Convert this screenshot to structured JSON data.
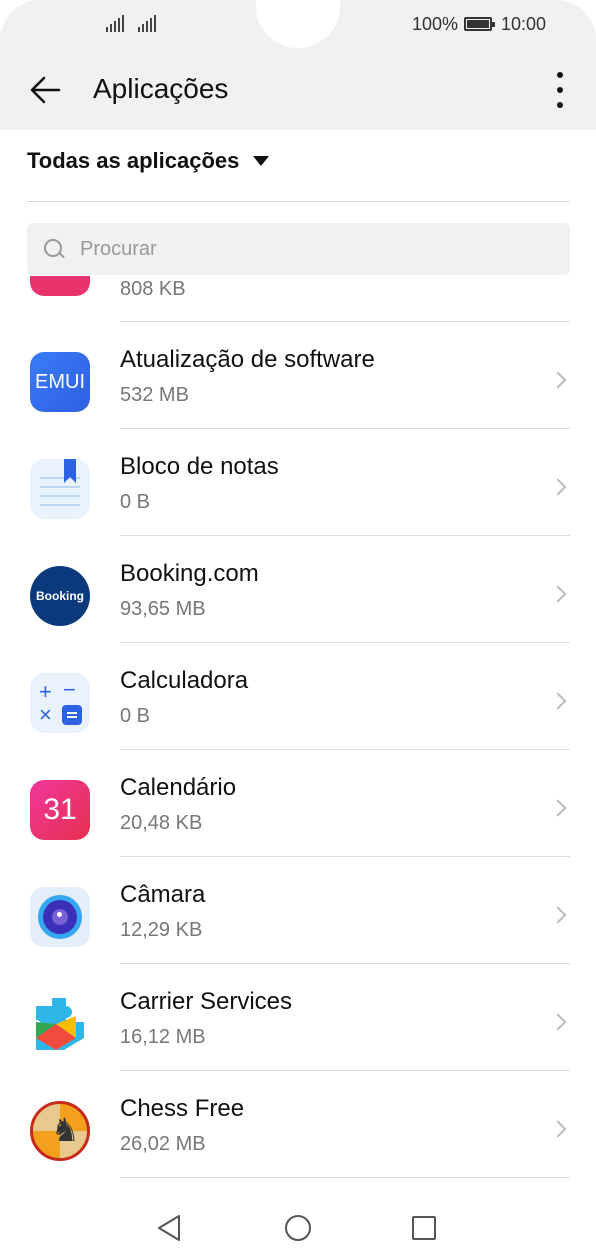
{
  "status_bar": {
    "battery_percent": "100%",
    "time": "10:00"
  },
  "header": {
    "title": "Aplicações"
  },
  "filter": {
    "label": "Todas as aplicações"
  },
  "search": {
    "placeholder": "Procurar"
  },
  "partial_item": {
    "size": "808 KB"
  },
  "apps": [
    {
      "name": "Atualização de software",
      "size": "532 MB",
      "icon": "emui-icon",
      "icon_text": "EMUI"
    },
    {
      "name": "Bloco de notas",
      "size": "0 B",
      "icon": "notepad-icon"
    },
    {
      "name": "Booking.com",
      "size": "93,65 MB",
      "icon": "booking-icon",
      "icon_text": "Booking"
    },
    {
      "name": "Calculadora",
      "size": "0 B",
      "icon": "calculator-icon"
    },
    {
      "name": "Calendário",
      "size": "20,48 KB",
      "icon": "calendar-icon",
      "icon_text": "31"
    },
    {
      "name": "Câmara",
      "size": "12,29 KB",
      "icon": "camera-icon"
    },
    {
      "name": "Carrier Services",
      "size": "16,12 MB",
      "icon": "carrier-services-icon"
    },
    {
      "name": "Chess Free",
      "size": "26,02 MB",
      "icon": "chess-icon"
    }
  ],
  "colors": {
    "header_bg": "#f1f1f1",
    "accent_blue": "#2d63e2",
    "divider": "#dcdcdc"
  }
}
